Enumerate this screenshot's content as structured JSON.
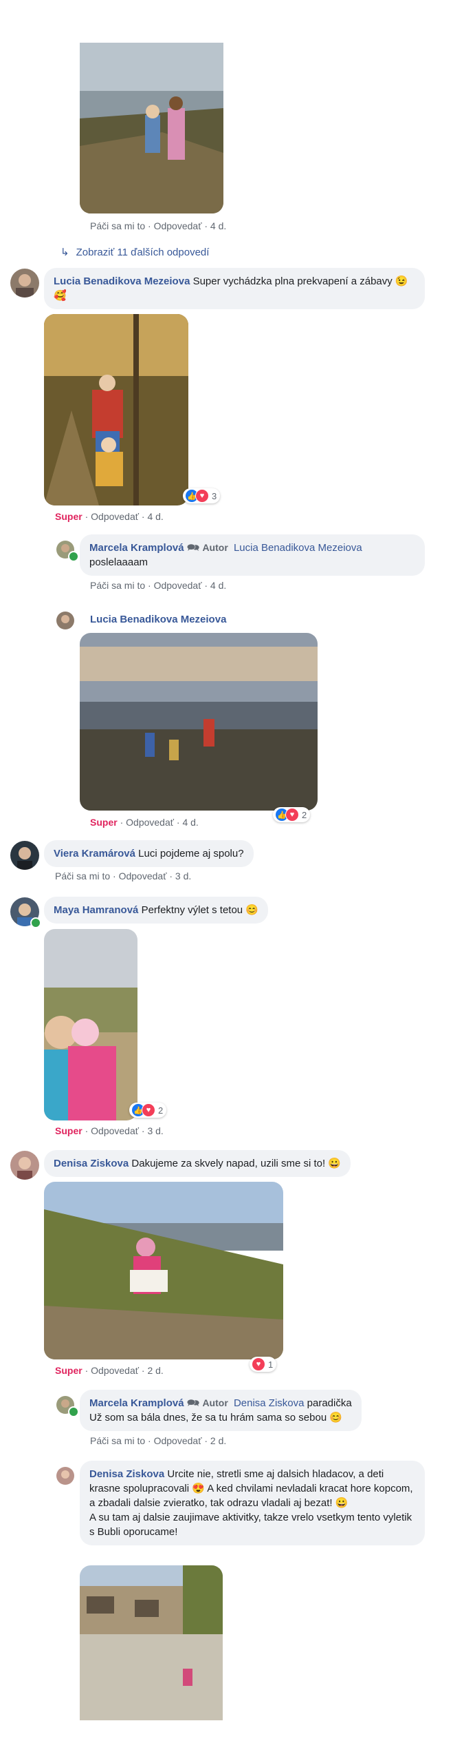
{
  "colors": {
    "link": "#385898",
    "super": "#e0245e",
    "bubble": "#f0f2f5",
    "like": "#1877f2",
    "love": "#f33e58"
  },
  "meta_like": "Páči sa mi to",
  "meta_reply": "Odpovedať",
  "meta_super": "Super",
  "meta_sep": "·",
  "author_badge": "Autor",
  "top_meta": {
    "time": "4 d."
  },
  "view_more": "Zobraziť 11 ďalších odpovedí",
  "comments": [
    {
      "name": "Lucia Benadikova Mezeiova",
      "text": "Super vychádzka plna prekvapení a zábavy 😉🥰",
      "reactions": "3",
      "time": "4 d."
    },
    {
      "name": "Marcela Kramplová",
      "tag": "Lucia Benadikova Mezeiova",
      "text": "poslelaaaam",
      "time": "4 d."
    },
    {
      "name": "Lucia Benadikova Mezeiova",
      "reactions": "2",
      "time": "4 d."
    },
    {
      "name": "Viera Kramárová",
      "text": "Luci pojdeme aj spolu?",
      "time": "3 d."
    },
    {
      "name": "Maya Hamranová",
      "text": "Perfektny výlet s tetou 😊",
      "reactions": "2",
      "time": "3 d."
    },
    {
      "name": "Denisa Ziskova",
      "text": "Dakujeme za skvely napad, uzili sme si to! 😀",
      "reactions": "1",
      "time": "2 d."
    },
    {
      "name": "Marcela Kramplová",
      "tag": "Denisa Ziskova",
      "text_a": "paradička",
      "text_b": "Už som sa bála dnes, že sa tu hrám sama so sebou 😊",
      "time": "2 d."
    },
    {
      "name": "Denisa Ziskova",
      "text_a": "Urcite nie, stretli sme aj dalsich hladacov, a deti krasne spolupracovali 😍 A ked chvilami nevladali kracat hore kopcom, a zbadali dalsie zvieratko, tak odrazu vladali aj bezat! 😀",
      "text_b": "A su tam aj dalsie zaujimave aktivitky, takze vrelo vsetkym tento vyletik s Bubli oporucame!"
    }
  ]
}
